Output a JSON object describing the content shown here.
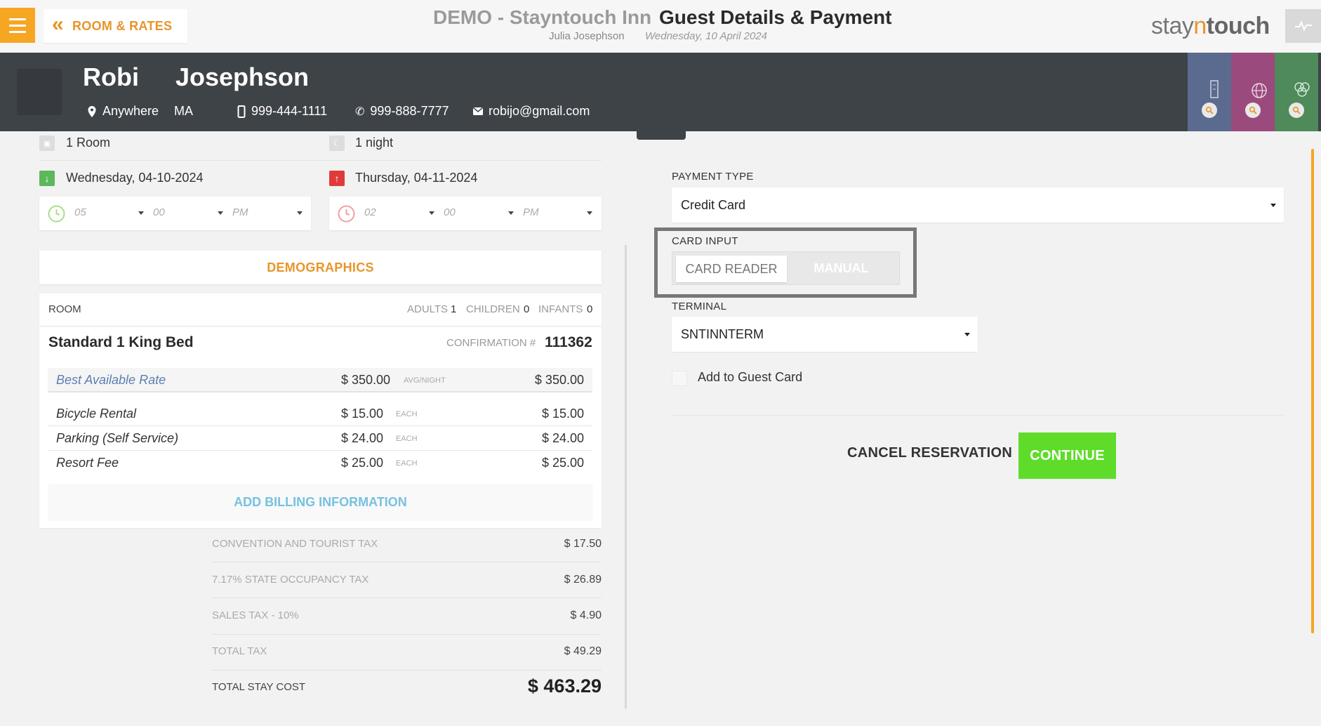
{
  "header": {
    "back_label": "ROOM & RATES",
    "hotel_name": "DEMO - Stayntouch Inn",
    "page_title": "Guest Details & Payment",
    "user_name": "Julia Josephson",
    "date": "Wednesday, 10 April 2024",
    "logo": {
      "part1": "stay",
      "part2": "n",
      "part3": "touch"
    }
  },
  "guest": {
    "first_name": "Robi",
    "last_name": "Josephson",
    "city": "Anywhere",
    "state": "MA",
    "mobile": "999-444-1111",
    "phone": "999-888-7777",
    "email": "robijo@gmail.com",
    "tab_colors": [
      "#5a6b8f",
      "#9b4a7d",
      "#4e8a5a"
    ]
  },
  "stay": {
    "rooms": "1 Room",
    "nights": "1 night",
    "arrival_date": "Wednesday, 04-10-2024",
    "departure_date": "Thursday, 04-11-2024",
    "arrival_time": {
      "hour": "05",
      "minute": "00",
      "ampm": "PM"
    },
    "departure_time": {
      "hour": "02",
      "minute": "00",
      "ampm": "PM"
    }
  },
  "demographics_label": "DEMOGRAPHICS",
  "room": {
    "heading": "ROOM",
    "adults_label": "ADULTS",
    "adults": "1",
    "children_label": "CHILDREN",
    "children": "0",
    "infants_label": "INFANTS",
    "infants": "0",
    "type": "Standard 1 King Bed",
    "confirmation_label": "CONFIRMATION #",
    "confirmation": "111362",
    "rate": {
      "name": "Best Available Rate",
      "price": "$ 350.00",
      "unit": "AVG/NIGHT",
      "total": "$ 350.00"
    },
    "addons": [
      {
        "name": "Bicycle Rental",
        "price": "$ 15.00",
        "unit": "EACH",
        "total": "$ 15.00"
      },
      {
        "name": "Parking (Self Service)",
        "price": "$ 24.00",
        "unit": "EACH",
        "total": "$ 24.00"
      },
      {
        "name": "Resort Fee",
        "price": "$ 25.00",
        "unit": "EACH",
        "total": "$ 25.00"
      }
    ],
    "add_billing_label": "ADD BILLING INFORMATION"
  },
  "taxes": [
    {
      "label": "CONVENTION AND TOURIST TAX",
      "value": "$ 17.50"
    },
    {
      "label": "7.17% STATE OCCUPANCY TAX",
      "value": "$ 26.89"
    },
    {
      "label": "SALES TAX - 10%",
      "value": "$ 4.90"
    },
    {
      "label": "TOTAL TAX",
      "value": "$ 49.29"
    }
  ],
  "total": {
    "label": "TOTAL STAY COST",
    "value": "$ 463.29"
  },
  "payment": {
    "payment_type_label": "PAYMENT TYPE",
    "payment_type": "Credit Card",
    "card_input_label": "CARD INPUT",
    "card_reader_label": "CARD READER",
    "manual_label": "MANUAL",
    "terminal_label": "TERMINAL",
    "terminal": "SNTINNTERM",
    "add_to_guest_card_label": "Add to Guest Card",
    "cancel_label": "CANCEL RESERVATION",
    "continue_label": "CONTINUE"
  },
  "colors": {
    "accent": "#f6a623",
    "continue": "#5fdc2a",
    "header_dark": "#3e4348",
    "link": "#76c2e0",
    "arrival": "#5cb85c",
    "departure": "#e03a3a"
  }
}
